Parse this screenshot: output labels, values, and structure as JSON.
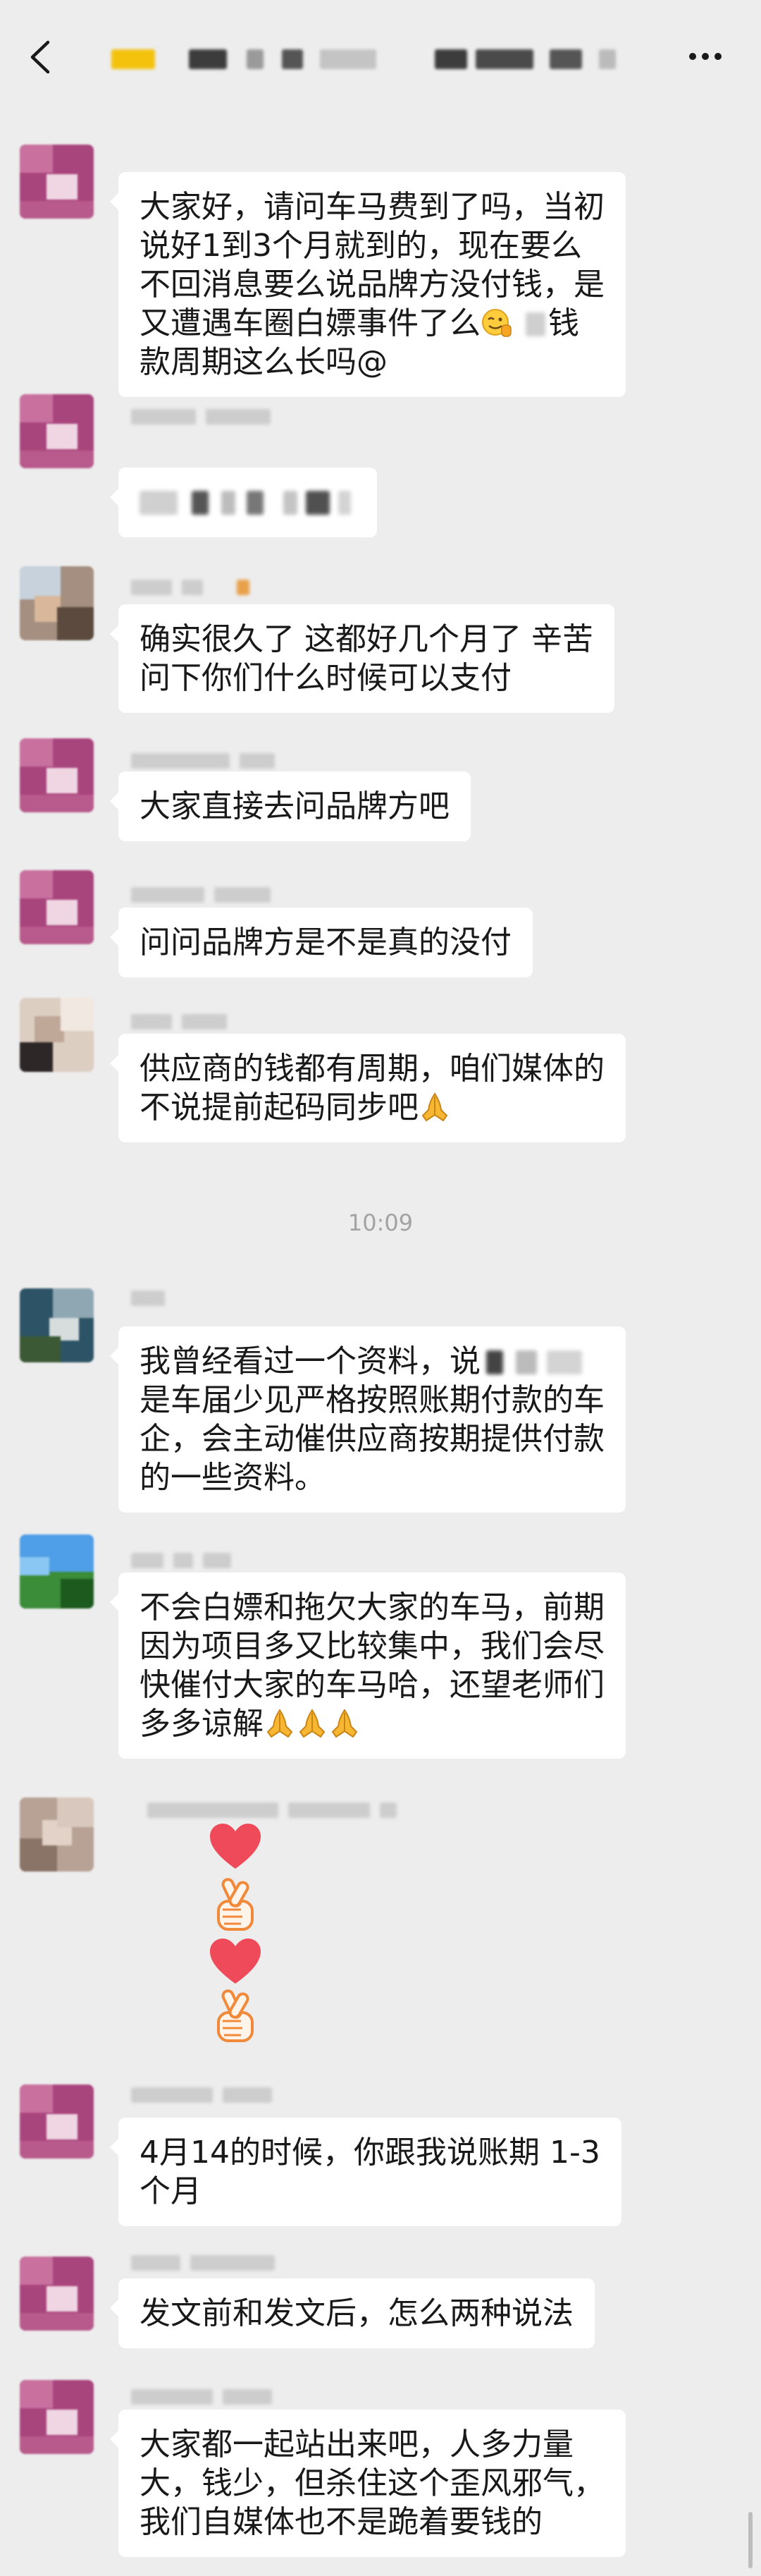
{
  "header": {
    "back_icon": "chevron-left-icon",
    "menu_icon": "more-dots-icon"
  },
  "colors": {
    "background": "#ededed",
    "bubble": "#ffffff",
    "text": "#191919",
    "timestamp": "#a3a3a3",
    "heart": "#ee4a5a",
    "hand_outline": "#f08a3a"
  },
  "timestamp": "10:09",
  "messages": [
    {
      "lines": [
        "大家好，请问车马费到了吗，当初",
        "说好1到3个月就到的，现在要么",
        "不回消息要么说品牌方没付钱，是",
        {
          "text": "又遭遇车圈白嫖事件了么",
          "emoji": "smirk-face",
          "after": "钱"
        },
        "款周期这么长吗@"
      ]
    },
    {
      "lines": []
    },
    {
      "lines": [
        "确实很久了 这都好几个月了 辛苦",
        "问下你们什么时候可以支付"
      ]
    },
    {
      "lines": [
        "大家直接去问品牌方吧"
      ]
    },
    {
      "lines": [
        "问问品牌方是不是真的没付"
      ]
    },
    {
      "lines": [
        "供应商的钱都有周期，咱们媒体的",
        {
          "text": "不说提前起码同步吧",
          "emoji": [
            "pray"
          ]
        }
      ]
    },
    {
      "lines": [
        {
          "text": "我曾经看过一个资料，说"
        },
        "是车届少见严格按照账期付款的车",
        "企，会主动催供应商按期提供付款",
        "的一些资料。"
      ]
    },
    {
      "lines": [
        "不会白嫖和拖欠大家的车马，前期",
        "因为项目多又比较集中，我们会尽",
        "快催付大家的车马哈，还望老师们",
        {
          "text": "多多谅解",
          "emoji": [
            "pray",
            "pray",
            "pray"
          ]
        }
      ]
    },
    {
      "stickers": [
        "heart",
        "finger-heart",
        "heart",
        "finger-heart"
      ]
    },
    {
      "lines": [
        "4月14的时候，你跟我说账期 1-3",
        "个月"
      ]
    },
    {
      "lines": [
        "发文前和发文后，怎么两种说法"
      ]
    },
    {
      "lines": [
        "大家都一起站出来吧，人多力量",
        "大，钱少，但杀住这个歪风邪气，",
        "我们自媒体也不是跪着要钱的"
      ]
    }
  ]
}
